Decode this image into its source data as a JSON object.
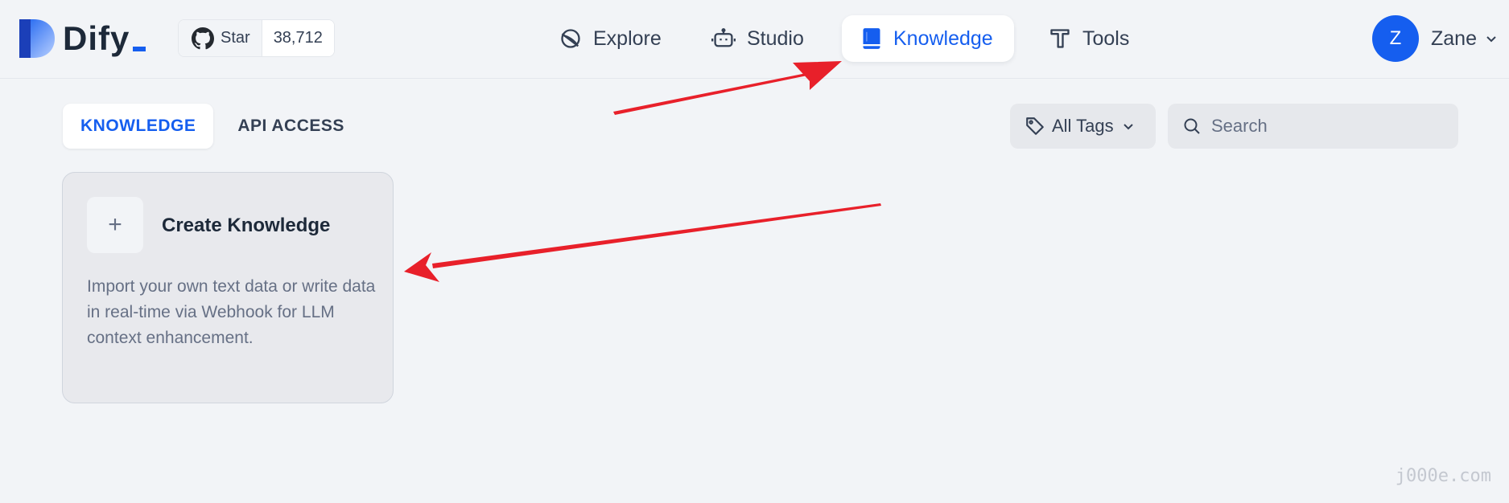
{
  "app": {
    "brand": "Dify",
    "brand_color": "#155eef"
  },
  "github": {
    "star_label": "Star",
    "count": "38,712",
    "icon": "github-icon"
  },
  "nav": {
    "explore": {
      "label": "Explore",
      "icon": "compass-icon"
    },
    "studio": {
      "label": "Studio",
      "icon": "robot-icon"
    },
    "knowledge": {
      "label": "Knowledge",
      "icon": "book-icon",
      "active": true
    },
    "tools": {
      "label": "Tools",
      "icon": "hammer-icon"
    }
  },
  "user": {
    "initial": "Z",
    "name": "Zane"
  },
  "tabs": [
    {
      "label": "KNOWLEDGE",
      "active": true
    },
    {
      "label": "API ACCESS",
      "active": false
    }
  ],
  "tags_filter": {
    "label": "All Tags"
  },
  "search": {
    "placeholder": "Search",
    "value": ""
  },
  "card": {
    "title": "Create Knowledge",
    "icon": "plus-icon",
    "description": "Import your own text data or write data in real-time via Webhook for LLM context enhancement."
  },
  "annotations": {
    "arrow_color": "#e8202a"
  },
  "watermark": "j000e.com"
}
